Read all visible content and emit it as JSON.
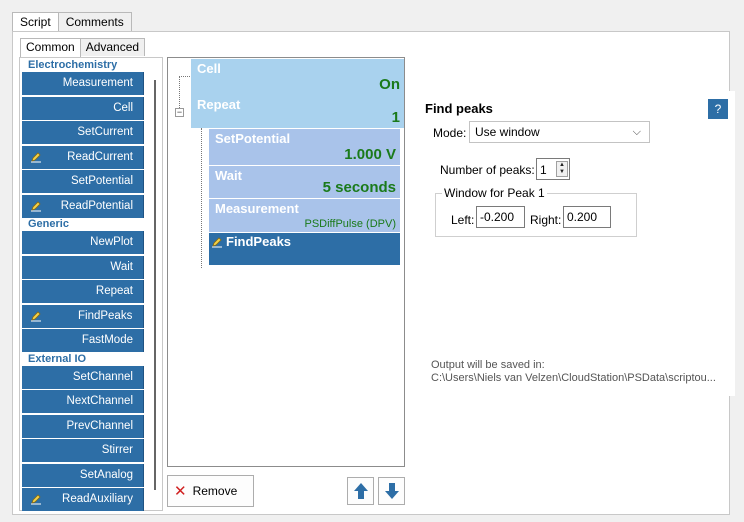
{
  "top_tabs": {
    "script": "Script",
    "comments": "Comments"
  },
  "sub_tabs": {
    "common": "Common",
    "advanced": "Advanced"
  },
  "palette": {
    "categories": {
      "electrochemistry": "Electrochemistry",
      "generic": "Generic",
      "external_io": "External IO"
    },
    "electrochemistry": [
      "Measurement",
      "Cell",
      "SetCurrent",
      "ReadCurrent",
      "SetPotential",
      "ReadPotential"
    ],
    "generic": [
      "NewPlot",
      "Wait",
      "Repeat",
      "FindPeaks",
      "FastMode"
    ],
    "external_io": [
      "SetChannel",
      "NextChannel",
      "PrevChannel",
      "Stirrer",
      "SetAnalog",
      "ReadAuxiliary"
    ]
  },
  "script": {
    "cell": {
      "title": "Cell",
      "value": "On"
    },
    "repeat": {
      "title": "Repeat",
      "value": "1"
    },
    "setpotential": {
      "title": "SetPotential",
      "value": "1.000 V"
    },
    "wait": {
      "title": "Wait",
      "value": "5 seconds"
    },
    "measurement": {
      "title": "Measurement",
      "value": "PSDiffPulse (DPV)"
    },
    "findpeaks": {
      "title": "FindPeaks"
    }
  },
  "buttons": {
    "remove": "Remove"
  },
  "properties": {
    "title": "Find peaks",
    "help": "?",
    "mode_label": "Mode:",
    "mode_value": "Use window",
    "num_peaks_label": "Number of peaks:",
    "num_peaks_value": "1",
    "window_group": "Window for Peak 1",
    "left_label": "Left:",
    "left_value": "-0.200",
    "right_label": "Right:",
    "right_value": "0.200",
    "output_label": "Output will be saved in:",
    "output_path": "C:\\Users\\Niels van Velzen\\CloudStation\\PSData\\scriptou..."
  },
  "colors": {
    "accent": "#2d6ea6",
    "value_green": "#1a7a1a",
    "block_light": "#a9d2ee",
    "block_nested": "#a9c3ea"
  }
}
